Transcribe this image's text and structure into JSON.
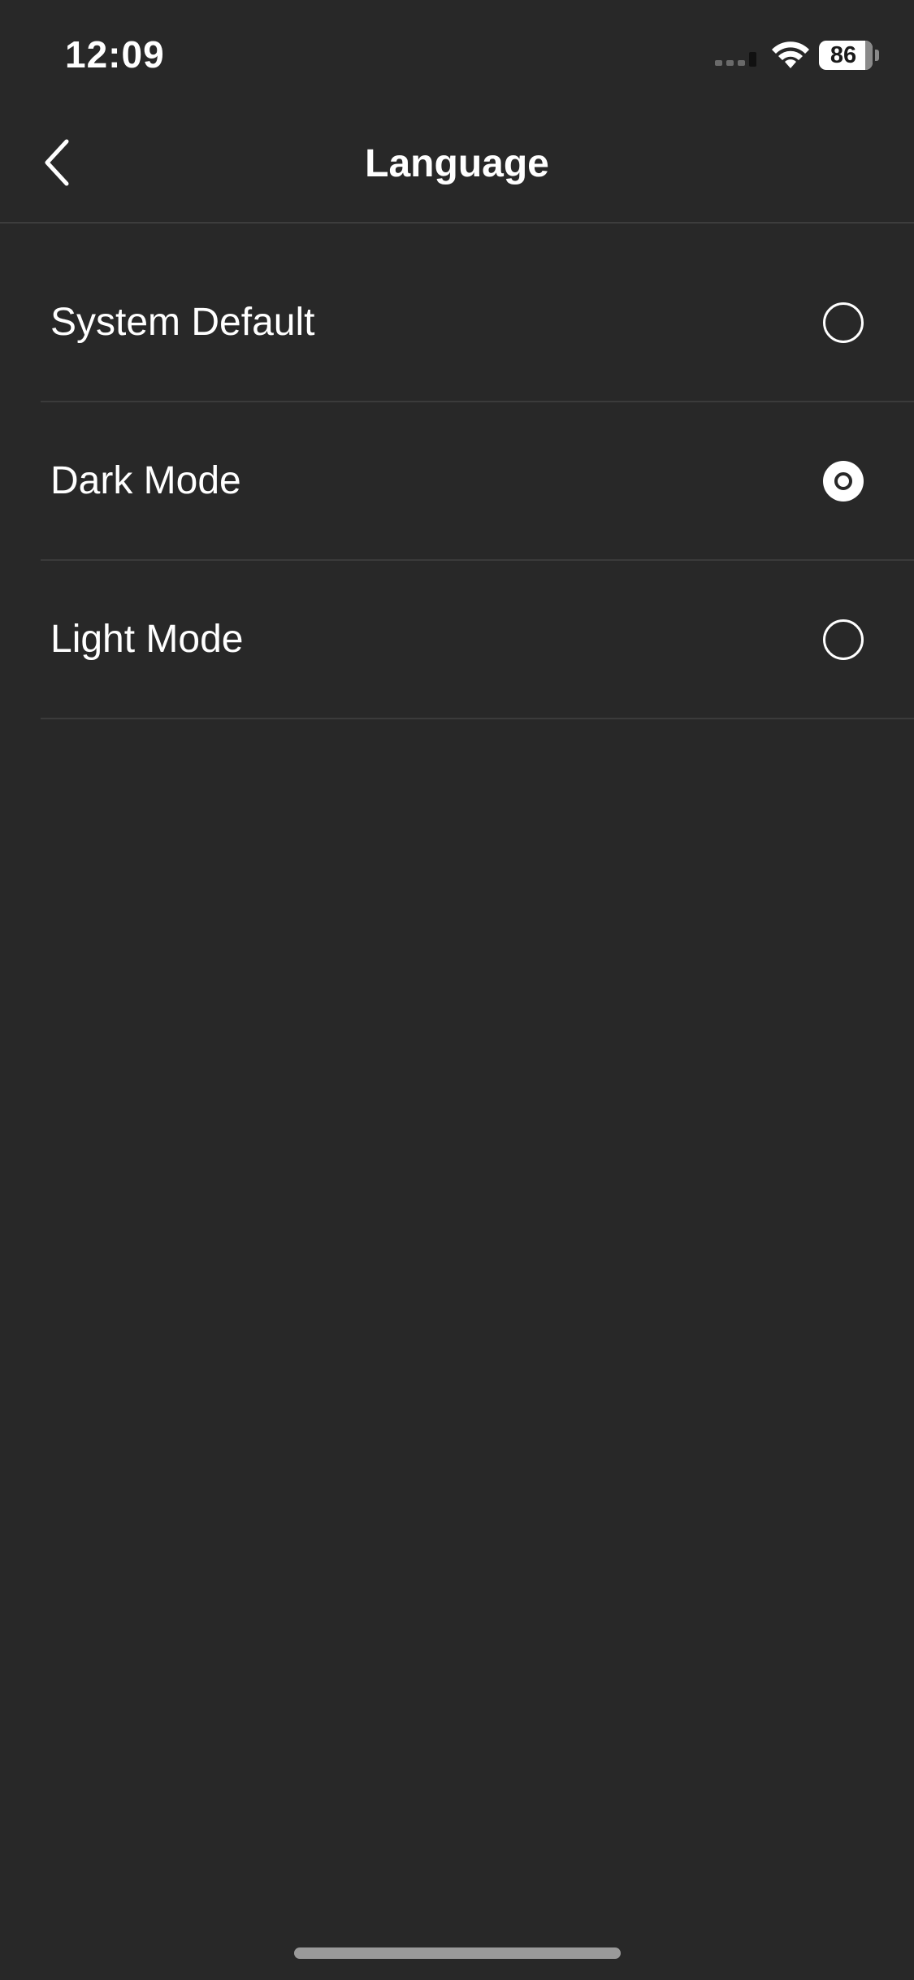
{
  "status_bar": {
    "time": "12:09",
    "battery_level": "86",
    "battery_fraction": 0.86,
    "icons": [
      "signal-icon",
      "wifi-icon",
      "battery-icon"
    ]
  },
  "nav": {
    "title": "Language",
    "back_icon": "chevron-left-icon"
  },
  "options": [
    {
      "label": "System Default",
      "selected": false
    },
    {
      "label": "Dark Mode",
      "selected": true
    },
    {
      "label": "Light Mode",
      "selected": false
    }
  ],
  "colors": {
    "background": "#282828",
    "text": "#ffffff",
    "divider": "#3b3b3b"
  }
}
